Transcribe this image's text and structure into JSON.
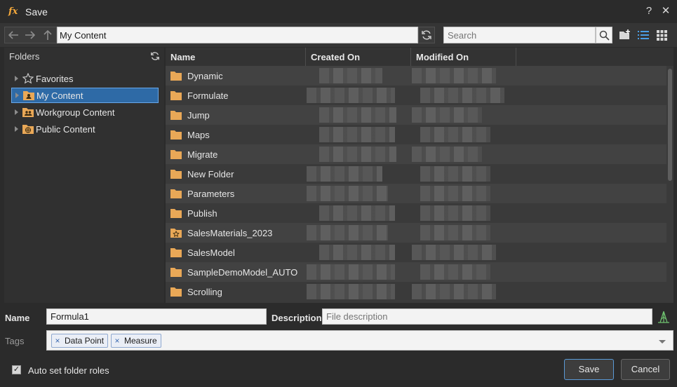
{
  "window": {
    "title": "Save",
    "icon": "fx-function-icon"
  },
  "toolbar": {
    "path": "My Content",
    "search_placeholder": "Search"
  },
  "folders": {
    "header": "Folders",
    "items": [
      {
        "label": "Favorites",
        "icon": "star-icon",
        "selected": false
      },
      {
        "label": "My Content",
        "icon": "user-folder-icon",
        "selected": true
      },
      {
        "label": "Workgroup Content",
        "icon": "group-folder-icon",
        "selected": false
      },
      {
        "label": "Public Content",
        "icon": "globe-folder-icon",
        "selected": false
      }
    ]
  },
  "list": {
    "columns": [
      "Name",
      "Created On",
      "Modified On"
    ],
    "rows": [
      {
        "name": "Dynamic",
        "icon": "folder-icon"
      },
      {
        "name": "Formulate",
        "icon": "folder-icon"
      },
      {
        "name": "Jump",
        "icon": "folder-icon"
      },
      {
        "name": "Maps",
        "icon": "folder-icon"
      },
      {
        "name": "Migrate",
        "icon": "folder-icon"
      },
      {
        "name": "New Folder",
        "icon": "folder-icon"
      },
      {
        "name": "Parameters",
        "icon": "folder-icon"
      },
      {
        "name": "Publish",
        "icon": "folder-icon"
      },
      {
        "name": "SalesMaterials_2023",
        "icon": "star-folder-icon"
      },
      {
        "name": "SalesModel",
        "icon": "folder-icon"
      },
      {
        "name": "SampleDemoModel_AUTO",
        "icon": "folder-icon"
      },
      {
        "name": "Scrolling",
        "icon": "folder-icon"
      }
    ]
  },
  "form": {
    "name_label": "Name",
    "name_value": "Formula1",
    "description_label": "Description",
    "description_placeholder": "File description",
    "tags_label": "Tags",
    "tags": [
      "Data Point",
      "Measure"
    ],
    "auto_roles_label": "Auto set folder roles",
    "auto_roles_checked": true,
    "save_label": "Save",
    "cancel_label": "Cancel"
  },
  "colors": {
    "accent": "#f2a73b",
    "selection": "#2e6aa6",
    "folder": "#e9a857"
  }
}
